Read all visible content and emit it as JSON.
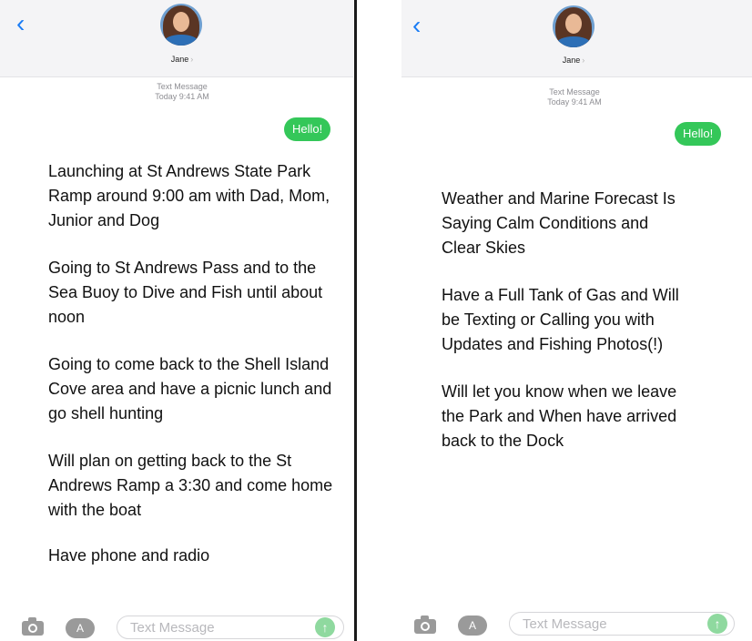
{
  "left": {
    "contact_name": "Jane",
    "timestamp_line1": "Text Message",
    "timestamp_line2": "Today 9:41 AM",
    "bubble": "Hello!",
    "messages": [
      "Launching at St Andrews State Park Ramp around 9:00 am with Dad, Mom, Junior and Dog",
      "Going to St Andrews Pass and to the Sea Buoy to Dive and Fish until about noon",
      "Going to come back to the Shell Island Cove area and have a picnic lunch and go shell hunting",
      "Will plan on getting back to the St Andrews Ramp a 3:30 and come home with the boat",
      "Have phone and radio"
    ],
    "input_placeholder": "Text Message"
  },
  "right": {
    "contact_name": "Jane",
    "timestamp_line1": "Text Message",
    "timestamp_line2": "Today 9:41 AM",
    "bubble": "Hello!",
    "messages": [
      "Weather and Marine Forecast Is Saying Calm Conditions and Clear Skies",
      "Have a Full Tank of Gas and Will be Texting or Calling you with Updates and Fishing Photos(!)",
      "Will let you know when we leave the Park and When have arrived back to the Dock"
    ],
    "input_placeholder": "Text Message"
  },
  "icons": {
    "back": "chevron-left-icon",
    "camera": "camera-icon",
    "apps": "app-store-icon",
    "send": "send-arrow-icon"
  },
  "colors": {
    "bubble": "#34c759",
    "accent": "#1a7cf5"
  }
}
